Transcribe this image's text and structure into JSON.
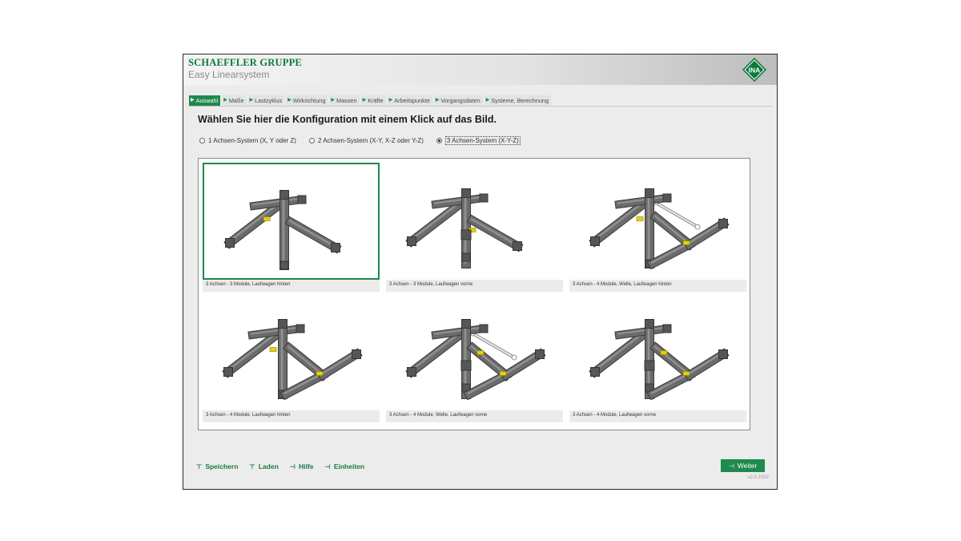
{
  "header": {
    "brand": "SCHAEFFLER GRUPPE",
    "product": "Easy Linearsystem",
    "logo_text": "INA",
    "logo_color": "#0b7a3b"
  },
  "tabs": [
    {
      "label": "Auswahl",
      "active": true
    },
    {
      "label": "Maße",
      "active": false
    },
    {
      "label": "Lastzyklus",
      "active": false
    },
    {
      "label": "Wirkrichtung",
      "active": false
    },
    {
      "label": "Massen",
      "active": false
    },
    {
      "label": "Kräfte",
      "active": false
    },
    {
      "label": "Arbeitspunkte",
      "active": false
    },
    {
      "label": "Vorgangsdaten",
      "active": false
    },
    {
      "label": "Systeme, Berechnung",
      "active": false
    }
  ],
  "main": {
    "headline": "Wählen Sie hier die Konfiguration mit einem Klick auf das Bild.",
    "radios": [
      {
        "label": "1 Achsen-System (X, Y oder Z)",
        "checked": false
      },
      {
        "label": "2 Achsen-System (X-Y, X-Z oder Y-Z)",
        "checked": false
      },
      {
        "label": "3 Achsen-System (X-Y-Z)",
        "checked": true
      }
    ],
    "cards": [
      {
        "caption": "3 Achsen - 3 Module, Laufwagen hinten",
        "selected": true,
        "variant": "3-rear"
      },
      {
        "caption": "3 Achsen - 3 Module, Laufwagen vorne",
        "selected": false,
        "variant": "3-front"
      },
      {
        "caption": "3 Achsen - 4 Module, Welle, Laufwagen hinten",
        "selected": false,
        "variant": "4-shaft-rear"
      },
      {
        "caption": "3 Achsen - 4 Module, Laufwagen hinten",
        "selected": false,
        "variant": "4-rear"
      },
      {
        "caption": "3 Achsen - 4 Module, Welle, Laufwagen vorne",
        "selected": false,
        "variant": "4-shaft-front"
      },
      {
        "caption": "3 Achsen - 4 Module, Laufwagen vorne",
        "selected": false,
        "variant": "4-front"
      }
    ]
  },
  "footer": {
    "links": [
      {
        "label": "Speichern",
        "icon": "save-icon"
      },
      {
        "label": "Laden",
        "icon": "load-icon"
      },
      {
        "label": "Hilfe",
        "icon": "help-icon"
      },
      {
        "label": "Einheiten",
        "icon": "units-icon"
      }
    ],
    "next_label": "Weiter",
    "version": "v2.0.1002"
  },
  "colors": {
    "accent": "#1f8a4d",
    "beam": "#6b6b6b",
    "carriage": "#e6d200"
  }
}
